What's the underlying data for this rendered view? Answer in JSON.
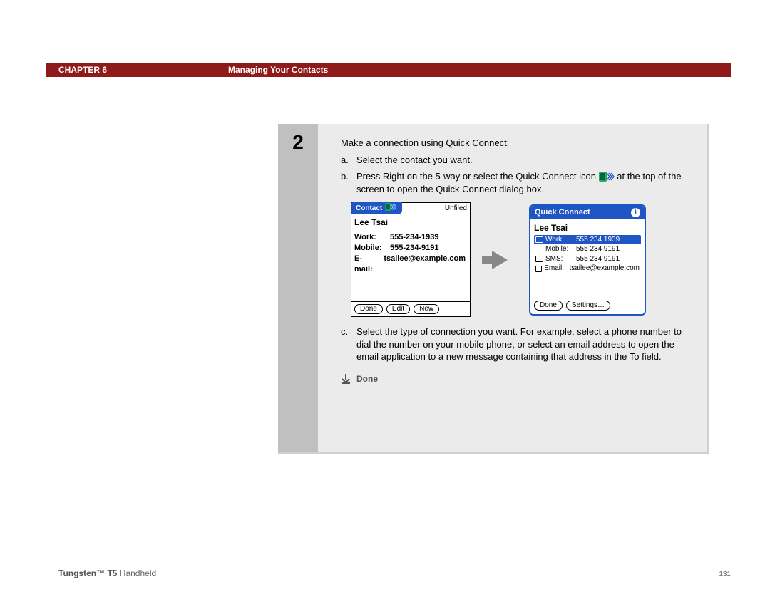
{
  "header": {
    "chapter": "CHAPTER 6",
    "title": "Managing Your Contacts"
  },
  "step": {
    "number": "2",
    "intro": "Make a connection using Quick Connect:",
    "items": {
      "a": {
        "bullet": "a.",
        "text": "Select the contact you want."
      },
      "b": {
        "bullet": "b.",
        "text_before": "Press Right on the 5-way or select the Quick Connect icon ",
        "text_after": " at the top of the screen to open the Quick Connect dialog box."
      },
      "c": {
        "bullet": "c.",
        "text": "Select the type of connection you want. For example, select a phone number to dial the number on your mobile phone, or select an email address to open the email application to a new message containing that address in the To field."
      }
    },
    "done_label": "Done"
  },
  "contact_screen": {
    "app_label": "Contact",
    "category": "Unfiled",
    "name": "Lee Tsai",
    "rows": {
      "work": {
        "label": "Work:",
        "value": "555-234-1939"
      },
      "mobile": {
        "label": "Mobile:",
        "value": "555-234-9191"
      },
      "email": {
        "label": "E-mail:",
        "value": "tsailee@example.com"
      }
    },
    "buttons": {
      "done": "Done",
      "edit": "Edit",
      "new": "New"
    }
  },
  "quickconnect_screen": {
    "title": "Quick Connect",
    "info": "i",
    "name": "Lee Tsai",
    "options": {
      "work": {
        "label": "Work:",
        "value": "555 234 1939",
        "selected": true
      },
      "mobile": {
        "label": "Mobile:",
        "value": "555 234 9191",
        "selected": false
      },
      "sms": {
        "label": "SMS:",
        "value": "555 234 9191",
        "selected": false
      },
      "email": {
        "label": "Email:",
        "value": "tsailee@example.com",
        "selected": false
      }
    },
    "buttons": {
      "done": "Done",
      "settings": "Settings…"
    }
  },
  "footer": {
    "product_bold": "Tungsten™ T5",
    "product_rest": " Handheld",
    "page": "131"
  }
}
